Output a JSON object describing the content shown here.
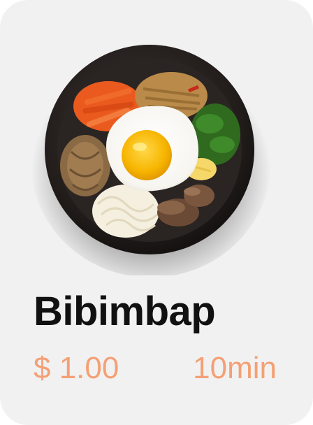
{
  "card": {
    "title": "Bibimbap",
    "price": "$ 1.00",
    "time": "10min",
    "image_icon": "bibimbap-bowl-photo"
  },
  "colors": {
    "background": "#f1f1f1",
    "title": "#111111",
    "accent": "#f4a075"
  }
}
